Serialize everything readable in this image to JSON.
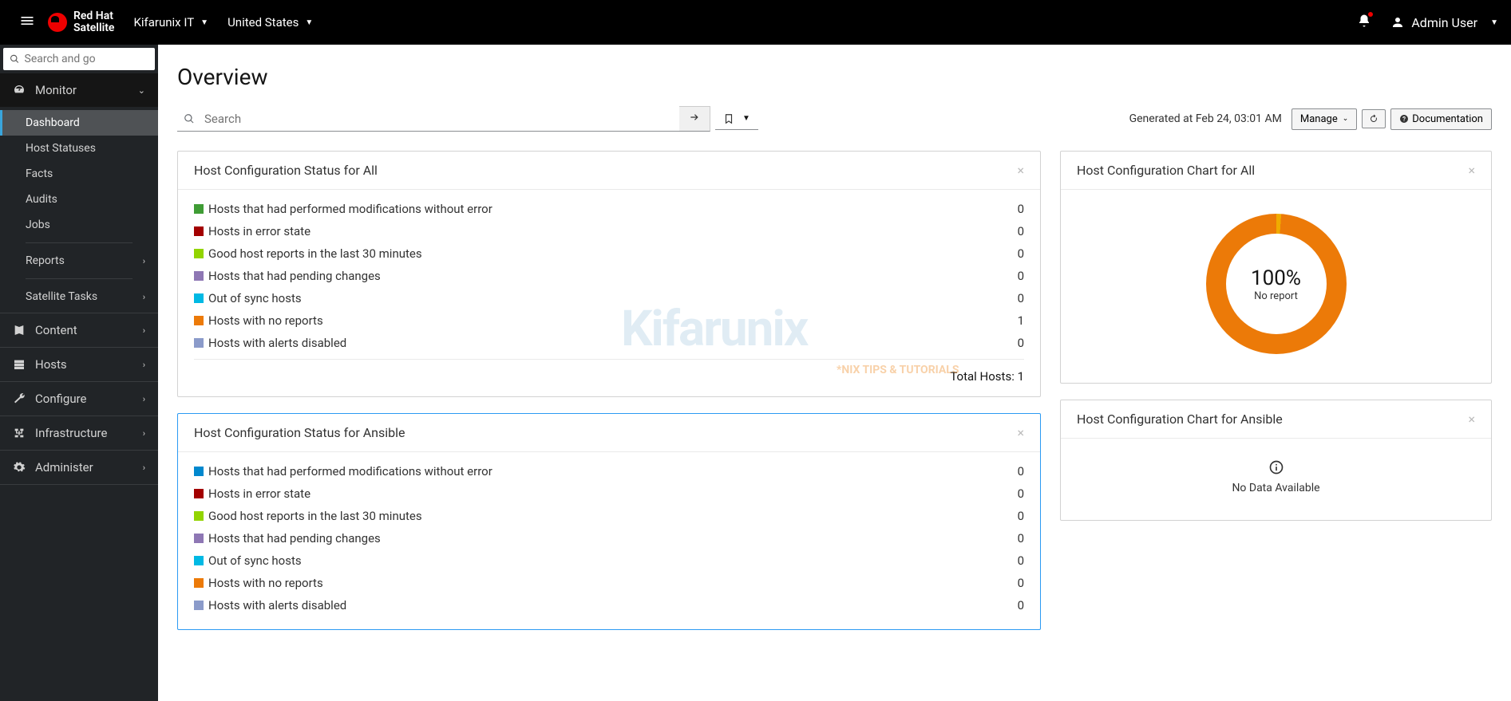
{
  "brand": {
    "line1": "Red Hat",
    "line2": "Satellite"
  },
  "top": {
    "org": "Kifarunix IT",
    "location": "United States",
    "user": "Admin User"
  },
  "sidebar": {
    "search_placeholder": "Search and go",
    "monitor": {
      "label": "Monitor",
      "items": [
        "Dashboard",
        "Host Statuses",
        "Facts",
        "Audits",
        "Jobs"
      ],
      "reports": "Reports",
      "tasks": "Satellite Tasks"
    },
    "content": "Content",
    "hosts": "Hosts",
    "configure": "Configure",
    "infrastructure": "Infrastructure",
    "administer": "Administer"
  },
  "page": {
    "title": "Overview",
    "search_placeholder": "Search",
    "generated": "Generated at Feb 24, 03:01 AM",
    "manage": "Manage",
    "documentation": "Documentation"
  },
  "widgets": {
    "status_all": {
      "title": "Host Configuration Status for All",
      "rows": [
        {
          "color": "#3f9c35",
          "alt": "#0088ce",
          "label": "Hosts that had performed modifications without error",
          "value": 0,
          "c": "#0088ce"
        },
        {
          "color": "#a30000",
          "label": "Hosts in error state",
          "value": 0
        },
        {
          "color": "#92d400",
          "label": "Good host reports in the last 30 minutes",
          "value": 0
        },
        {
          "color": "#8e77b4",
          "label": "Hosts that had pending changes",
          "value": 0
        },
        {
          "color": "#00b9e4",
          "label": "Out of sync hosts",
          "value": 0
        },
        {
          "color": "#ec7a08",
          "label": "Hosts with no reports",
          "value": 1
        },
        {
          "color": "#8b9bca",
          "label": "Hosts with alerts disabled",
          "value": 0
        }
      ],
      "total_label": "Total Hosts:",
      "total_value": 1
    },
    "chart_all": {
      "title": "Host Configuration Chart for All",
      "percent": "100%",
      "percent_label": "No report"
    },
    "status_ansible": {
      "title": "Host Configuration Status for Ansible",
      "rows": [
        {
          "color": "#0088ce",
          "label": "Hosts that had performed modifications without error",
          "value": 0
        },
        {
          "color": "#a30000",
          "label": "Hosts in error state",
          "value": 0
        },
        {
          "color": "#92d400",
          "label": "Good host reports in the last 30 minutes",
          "value": 0
        },
        {
          "color": "#8e77b4",
          "label": "Hosts that had pending changes",
          "value": 0
        },
        {
          "color": "#00b9e4",
          "label": "Out of sync hosts",
          "value": 0
        },
        {
          "color": "#ec7a08",
          "label": "Hosts with no reports",
          "value": 0
        },
        {
          "color": "#8b9bca",
          "label": "Hosts with alerts disabled",
          "value": 0
        }
      ]
    },
    "chart_ansible": {
      "title": "Host Configuration Chart for Ansible",
      "no_data": "No Data Available"
    }
  },
  "chart_data": {
    "type": "pie",
    "title": "Host Configuration Chart for All",
    "series": [
      {
        "name": "No report",
        "value": 100
      }
    ],
    "center_label": "100% No report"
  },
  "watermark": {
    "main": "Kifarunix",
    "sub": "*NIX TIPS & TUTORIALS"
  }
}
